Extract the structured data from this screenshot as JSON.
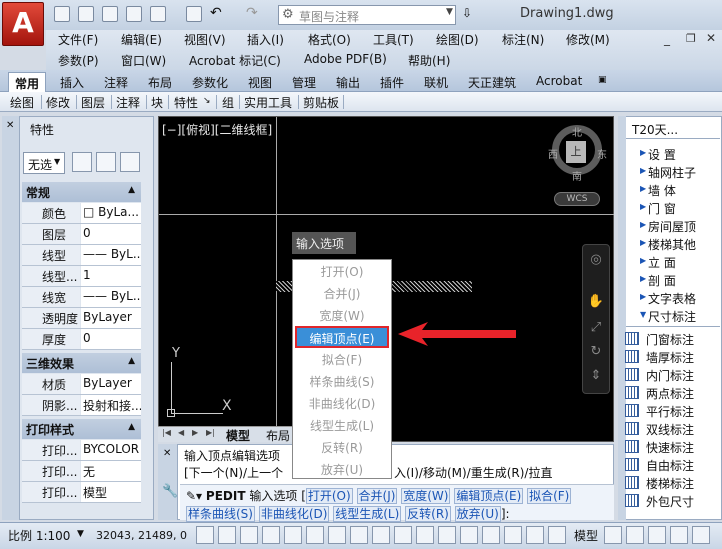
{
  "app": {
    "logo_letter": "A",
    "document_title": "Drawing1.dwg",
    "workspace": "草图与注释",
    "accent_color": "#c0392b"
  },
  "menu": {
    "row1": [
      "文件(F)",
      "编辑(E)",
      "视图(V)",
      "插入(I)",
      "格式(O)",
      "工具(T)",
      "绘图(D)",
      "标注(N)",
      "修改(M)"
    ],
    "row2": [
      "参数(P)",
      "窗口(W)",
      "Acrobat 标记(C)",
      "Adobe PDF(B)",
      "帮助(H)"
    ]
  },
  "ribbon_tabs": [
    {
      "label": "常用",
      "active": true
    },
    {
      "label": "插入"
    },
    {
      "label": "注释"
    },
    {
      "label": "布局"
    },
    {
      "label": "参数化"
    },
    {
      "label": "视图"
    },
    {
      "label": "管理"
    },
    {
      "label": "输出"
    },
    {
      "label": "插件"
    },
    {
      "label": "联机"
    },
    {
      "label": "天正建筑"
    },
    {
      "label": "Acrobat"
    }
  ],
  "panel_tabs": [
    "绘图",
    "修改",
    "图层",
    "注释",
    "块",
    "特性",
    "组",
    "实用工具",
    "剪贴板"
  ],
  "properties": {
    "title": "特性",
    "selection": "无选",
    "groups": [
      {
        "title": "常规",
        "rows": [
          {
            "key": "颜色",
            "value": "□ ByLa..."
          },
          {
            "key": "图层",
            "value": "0"
          },
          {
            "key": "线型",
            "value": "—— ByL..."
          },
          {
            "key": "线型...",
            "value": "1"
          },
          {
            "key": "线宽",
            "value": "—— ByL..."
          },
          {
            "key": "透明度",
            "value": "ByLayer"
          },
          {
            "key": "厚度",
            "value": "0"
          }
        ]
      },
      {
        "title": "三维效果",
        "rows": [
          {
            "key": "材质",
            "value": "ByLayer"
          },
          {
            "key": "阴影...",
            "value": "投射和接..."
          }
        ]
      },
      {
        "title": "打印样式",
        "rows": [
          {
            "key": "打印...",
            "value": "BYCOLOR"
          },
          {
            "key": "打印...",
            "value": "无"
          },
          {
            "key": "打印...",
            "value": "模型"
          }
        ]
      }
    ]
  },
  "viewport": {
    "label": "[−][俯视][二维线框]",
    "compass": {
      "n": "北",
      "s": "南",
      "e": "东",
      "w": "西",
      "cube": "上"
    },
    "wcs": "WCS",
    "ucs": {
      "x": "X",
      "y": "Y"
    }
  },
  "context_menu": {
    "title": "输入选项",
    "items": [
      {
        "label": "打开(O)"
      },
      {
        "label": "合并(J)"
      },
      {
        "label": "宽度(W)"
      },
      {
        "label": "编辑顶点(E)",
        "selected": true
      },
      {
        "label": "拟合(F)"
      },
      {
        "label": "样条曲线(S)"
      },
      {
        "label": "非曲线化(D)"
      },
      {
        "label": "线型生成(L)"
      },
      {
        "label": "反转(R)"
      },
      {
        "label": "放弃(U)"
      }
    ]
  },
  "layout_tabs": [
    "模型",
    "布局"
  ],
  "command": {
    "history1": "输入顶点编辑选项",
    "history2": "[下一个(N)/上一个",
    "history2_tail": "入(I)/移动(M)/重生成(R)/拉直",
    "prompt_cmd": "PEDIT",
    "prompt_label": "输入选项",
    "options_line1": [
      "打开(O)",
      "合并(J)",
      "宽度(W)",
      "编辑顶点(E)",
      "拟合(F)"
    ],
    "options_line2": [
      "样条曲线(S)",
      "非曲线化(D)",
      "线型生成(L)",
      "反转(R)",
      "放弃(U)"
    ],
    "tail": "]:"
  },
  "t20": {
    "title": "T20天...",
    "categories": [
      "设  置",
      "轴网柱子",
      "墙  体",
      "门  窗",
      "房间屋顶",
      "楼梯其他",
      "立  面",
      "剖  面",
      "文字表格",
      "尺寸标注"
    ],
    "dims": [
      "门窗标注",
      "墙厚标注",
      "内门标注",
      "两点标注",
      "平行标注",
      "双线标注",
      "快速标注",
      "自由标注",
      "楼梯标注",
      "外包尺寸"
    ]
  },
  "status": {
    "scale": "比例 1:100",
    "coords": "32043, 21489, 0",
    "model": "模型"
  }
}
